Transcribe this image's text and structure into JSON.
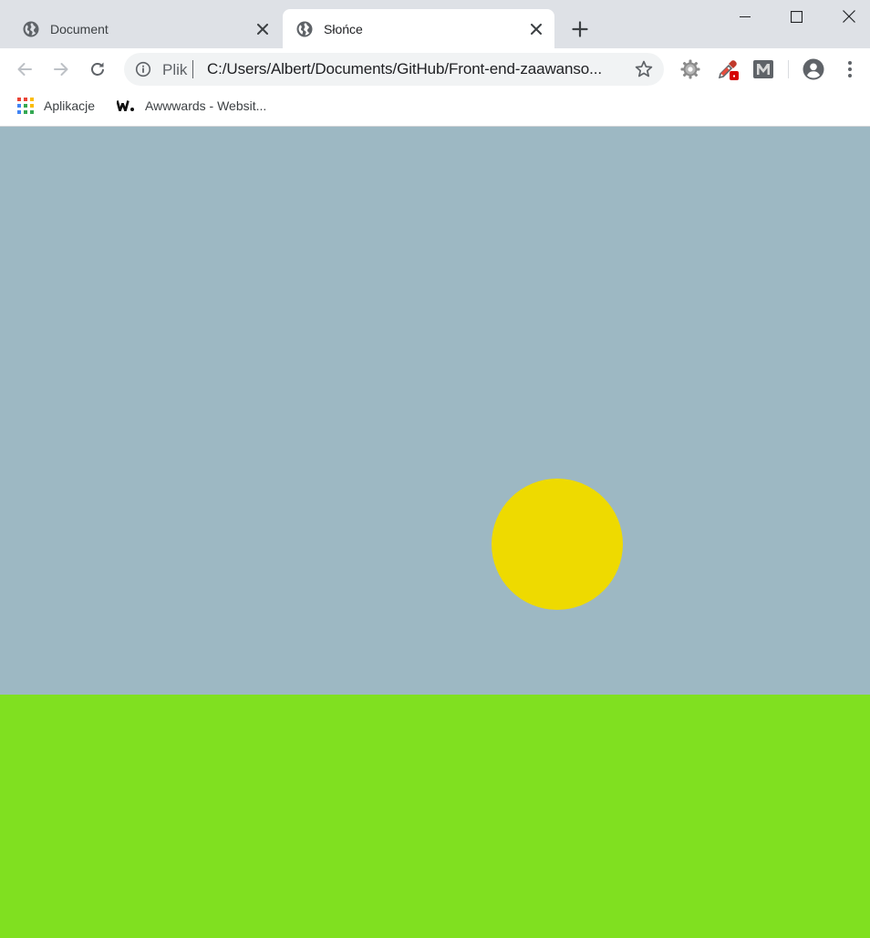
{
  "tabs": [
    {
      "title": "Document",
      "active": false,
      "favicon": "globe-icon"
    },
    {
      "title": "Słońce",
      "active": true,
      "favicon": "globe-icon"
    }
  ],
  "omnibox": {
    "scheme_label": "Plik",
    "url": "C:/Users/Albert/Documents/GitHub/Front-end-zaawanso..."
  },
  "bookmarks": [
    {
      "label": "Aplikacje",
      "icon": "apps-grid-icon"
    },
    {
      "label": "Awwwards - Websit...",
      "icon": "awwwards-logo-icon"
    }
  ],
  "scene": {
    "sky_color": "#9db8c3",
    "ground_color": "#80e020",
    "sun_color": "#eeda00"
  },
  "colors": {
    "titlebar": "#dee1e6",
    "toolbar": "#ffffff",
    "icon": "#5f6368"
  }
}
